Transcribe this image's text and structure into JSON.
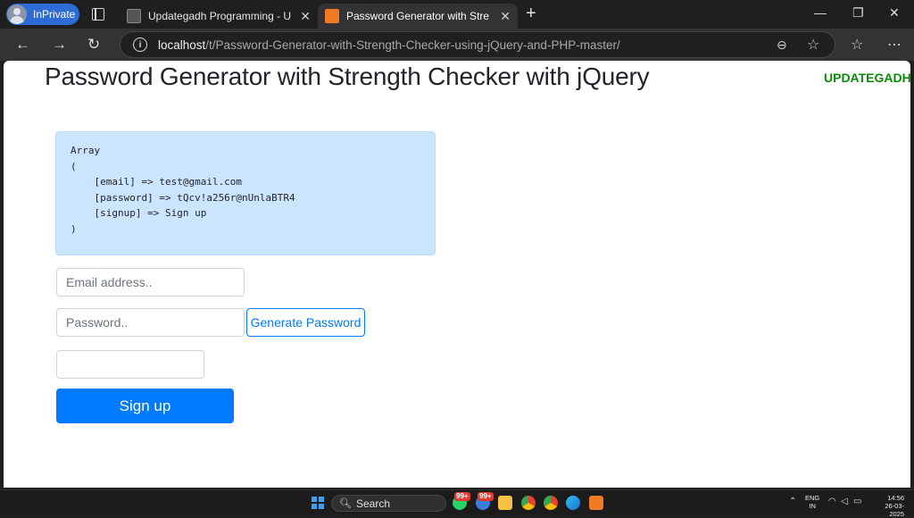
{
  "browser": {
    "inprivate_label": "InPrivate",
    "tabs": [
      {
        "title": "Updategadh Programming - Upd",
        "active": false
      },
      {
        "title": "Password Generator with Strength",
        "active": true
      }
    ],
    "url_host": "localhost",
    "url_path": "/t/Password-Generator-with-Strength-Checker-using-jQuery-and-PHP-master/"
  },
  "page": {
    "title": "Password Generator with Strength Checker with jQuery",
    "brand": "UPDATEGADH",
    "output": "Array\n(\n    [email] => test@gmail.com\n    [password] => tQcv!a256r@nUnlaBTR4\n    [signup] => Sign up\n)",
    "form": {
      "email_placeholder": "Email address..",
      "password_placeholder": "Password..",
      "generate_label": "Generate Password",
      "strength_value": "",
      "signup_label": "Sign up"
    }
  },
  "taskbar": {
    "search_label": "Search",
    "badge_1": "99+",
    "badge_2": "99+",
    "lang_line1": "ENG",
    "lang_line2": "IN",
    "time": "14:56",
    "date": "26-03-2025"
  },
  "colors": {
    "primary": "#007bff",
    "brand_green": "#0b8a0b",
    "alert_bg": "#cce5ff"
  }
}
